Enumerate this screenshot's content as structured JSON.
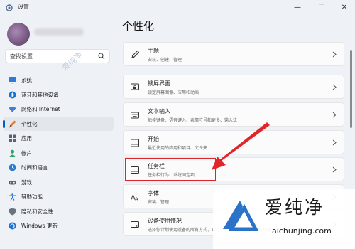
{
  "window": {
    "title": "设置",
    "min": "—",
    "max": "☐",
    "close": "✕"
  },
  "sidebar": {
    "search_placeholder": "查找设置",
    "items": [
      {
        "label": "系统",
        "icon": "monitor-icon",
        "active": false
      },
      {
        "label": "蓝牙和其他设备",
        "icon": "bluetooth-icon",
        "active": false
      },
      {
        "label": "网络和 Internet",
        "icon": "wifi-icon",
        "active": false
      },
      {
        "label": "个性化",
        "icon": "brush-icon",
        "active": true
      },
      {
        "label": "应用",
        "icon": "apps-icon",
        "active": false
      },
      {
        "label": "帐户",
        "icon": "person-icon",
        "active": false
      },
      {
        "label": "时间和语言",
        "icon": "globe-clock-icon",
        "active": false
      },
      {
        "label": "游戏",
        "icon": "gamepad-icon",
        "active": false
      },
      {
        "label": "辅助功能",
        "icon": "accessibility-icon",
        "active": false
      },
      {
        "label": "隐私和安全性",
        "icon": "shield-icon",
        "active": false
      },
      {
        "label": "Windows 更新",
        "icon": "update-icon",
        "active": false
      }
    ]
  },
  "main": {
    "title": "个性化",
    "cards": [
      {
        "title": "主题",
        "subtitle": "安装、创建、管理",
        "icon": "brush-icon"
      },
      {
        "title": "锁屏界面",
        "subtitle": "锁定屏幕图像、应用和动画",
        "icon": "lockscreen-icon"
      },
      {
        "title": "文本输入",
        "subtitle": "触摸键盘、语音键入、表情符号和更多、输入法",
        "icon": "keyboard-icon"
      },
      {
        "title": "开始",
        "subtitle": "最近使用的应用和项目、文件夹",
        "icon": "start-icon"
      },
      {
        "title": "任务栏",
        "subtitle": "任务栏行为、系统固定项",
        "icon": "taskbar-icon"
      },
      {
        "title": "字体",
        "subtitle": "安装、管理",
        "icon": "font-icon"
      },
      {
        "title": "设备使用情况",
        "subtitle": "选择你计划使用设备的所有方式，以获取个性化的提示、广告和建议",
        "icon": "device-icon"
      }
    ]
  },
  "watermark": {
    "top_text": "爱纯净",
    "logo_chars": "爱纯净",
    "url": "aichunjing.com"
  },
  "colors": {
    "accent": "#005fb8",
    "highlight": "#d8262a"
  }
}
